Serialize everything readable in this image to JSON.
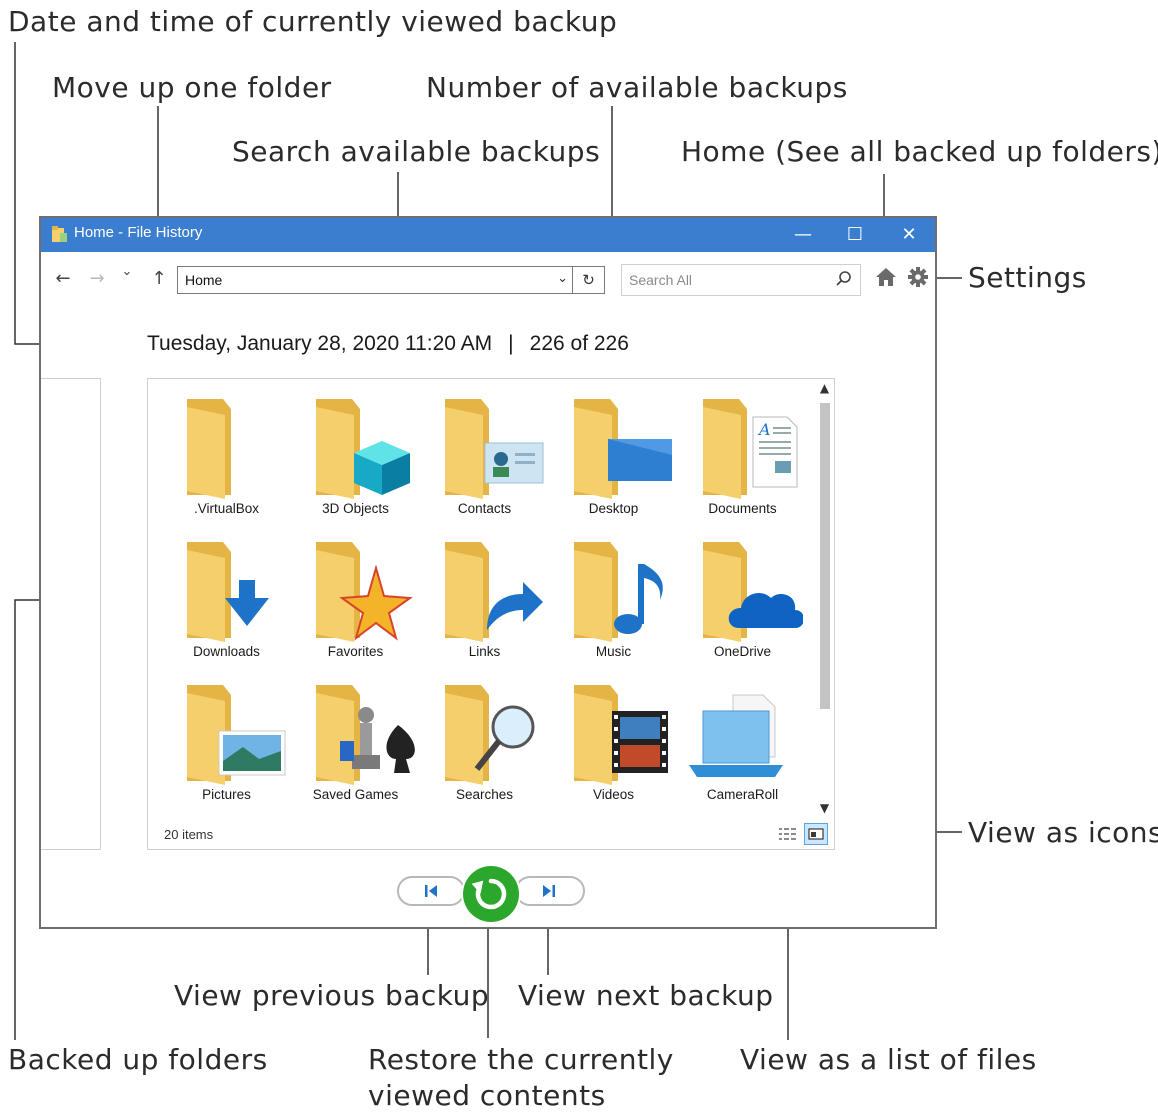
{
  "callouts": {
    "date_time": "Date and time of currently viewed backup",
    "move_up": "Move up one folder",
    "number_backups": "Number of available backups",
    "search_backups": "Search available backups",
    "home": "Home (See all backed up folders)",
    "settings": "Settings",
    "view_icons": "View as icons",
    "view_previous": "View previous backup",
    "view_next": "View next backup",
    "backed_up_folders": "Backed up folders",
    "restore": "Restore the currently\nviewed contents",
    "view_list": "View as a list of files"
  },
  "window": {
    "title": "Home - File History",
    "minimize_glyph": "—",
    "maximize_glyph": "☐",
    "close_glyph": "✕"
  },
  "toolbar": {
    "back_glyph": "←",
    "forward_glyph": "→",
    "recent_glyph": "⌄",
    "up_glyph": "↑",
    "address_value": "Home",
    "address_dropdown_glyph": "⌄",
    "refresh_glyph": "↻",
    "search_placeholder": "Search All"
  },
  "info": {
    "datetime": "Tuesday, January 28, 2020 11:20 AM",
    "separator": "|",
    "backup_count": "226 of 226"
  },
  "folders": [
    {
      "label": ".VirtualBox",
      "overlay": "none"
    },
    {
      "label": "3D Objects",
      "overlay": "cube"
    },
    {
      "label": "Contacts",
      "overlay": "contact-card"
    },
    {
      "label": "Desktop",
      "overlay": "desktop-pane"
    },
    {
      "label": "Documents",
      "overlay": "document"
    },
    {
      "label": "Downloads",
      "overlay": "down-arrow"
    },
    {
      "label": "Favorites",
      "overlay": "star"
    },
    {
      "label": "Links",
      "overlay": "link-arrow"
    },
    {
      "label": "Music",
      "overlay": "music-note"
    },
    {
      "label": "OneDrive",
      "overlay": "cloud"
    },
    {
      "label": "Pictures",
      "overlay": "landscape-photo"
    },
    {
      "label": "Saved Games",
      "overlay": "chess-pieces"
    },
    {
      "label": "Searches",
      "overlay": "magnifier"
    },
    {
      "label": "Videos",
      "overlay": "film-strip"
    },
    {
      "label": "CameraRoll",
      "overlay": "camera-roll"
    }
  ],
  "status": {
    "items_count": "20 items"
  },
  "colors": {
    "titlebar": "#3b7ed0",
    "folder_front": "#f5cf6b",
    "folder_back": "#e4b444",
    "restore_green": "#2ba82b",
    "accent_blue": "#1e73c8"
  }
}
